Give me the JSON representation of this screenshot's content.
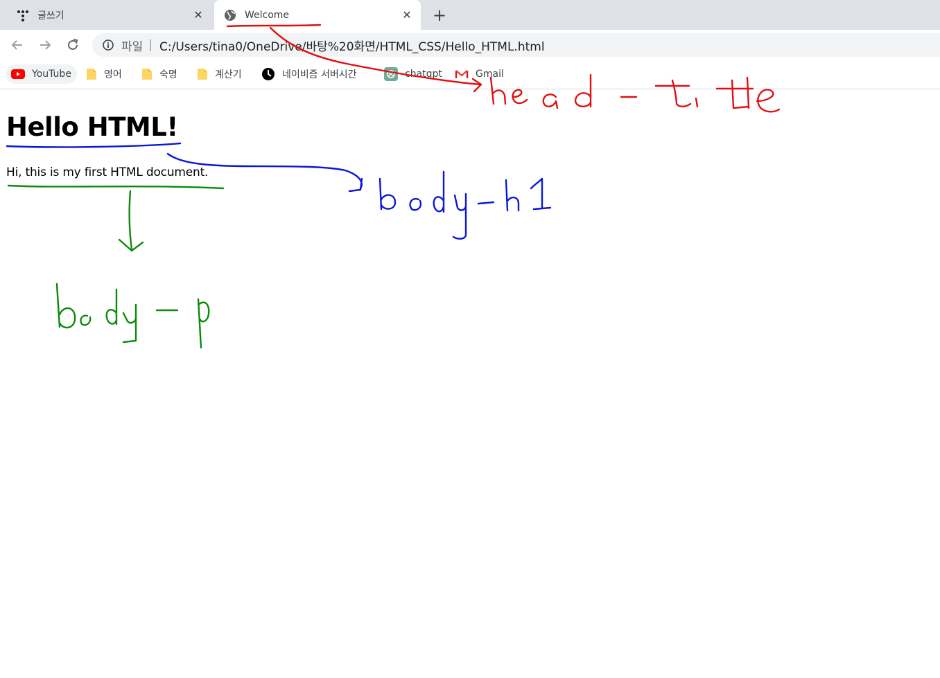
{
  "tabs": [
    {
      "title": "글쓰기",
      "icon": "app-dots-icon",
      "active": false
    },
    {
      "title": "Welcome",
      "icon": "globe-icon",
      "active": true
    }
  ],
  "new_tab_label": "+",
  "close_glyph": "✕",
  "toolbar": {
    "scheme_label": "파일",
    "separator": "|",
    "url": "C:/Users/tina0/OneDrive/바탕%20화면/HTML_CSS/Hello_HTML.html"
  },
  "bookmarks": [
    {
      "label": "YouTube",
      "icon": "youtube-icon"
    },
    {
      "label": "영어",
      "icon": "folder-icon"
    },
    {
      "label": "숙명",
      "icon": "folder-icon"
    },
    {
      "label": "계산기",
      "icon": "folder-icon"
    },
    {
      "label": "네이비즘 서버시간",
      "icon": "clock-icon"
    },
    {
      "label": "chatgpt",
      "icon": "chatgpt-icon"
    },
    {
      "label": "Gmail",
      "icon": "gmail-icon"
    }
  ],
  "page": {
    "heading": "Hello HTML!",
    "paragraph": "Hi, this is my first HTML document."
  },
  "annotations": {
    "red_color": "#e01010",
    "blue_color": "#0a17d6",
    "green_color": "#0a8a0a"
  },
  "colors": {
    "tabstrip_bg": "#dee1e6",
    "omnibox_bg": "#f1f3f4",
    "youtube_red": "#ff0000",
    "folder_yellow": "#fcd663"
  }
}
